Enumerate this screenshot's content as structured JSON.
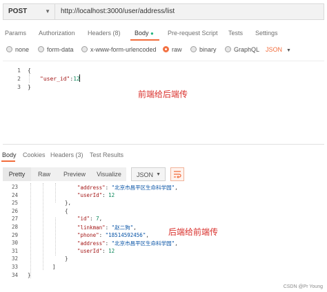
{
  "request": {
    "method": "POST",
    "url": "http://localhost:3000/user/address/list"
  },
  "request_tabs": [
    "Params",
    "Authorization",
    "Headers (8)",
    "Body",
    "Pre-request Script",
    "Tests",
    "Settings"
  ],
  "body_types": [
    "none",
    "form-data",
    "x-www-form-urlencoded",
    "raw",
    "binary",
    "GraphQL"
  ],
  "body_format": "JSON",
  "editor": {
    "lines": [
      {
        "n": "1",
        "text": "{"
      },
      {
        "n": "2",
        "key": "\"user_id\"",
        "sep": ":",
        "val": "12"
      },
      {
        "n": "3",
        "text": "}"
      }
    ],
    "annotation": "前端给后端传"
  },
  "response_tabs": [
    "Body",
    "Cookies",
    "Headers (3)",
    "Test Results"
  ],
  "response_toolbar": {
    "pretty": "Pretty",
    "raw": "Raw",
    "preview": "Preview",
    "visualize": "Visualize",
    "format": "JSON"
  },
  "response": {
    "lines": [
      {
        "n": "23",
        "indent": 16,
        "key": "\"address\"",
        "val": "\"北京市昌平区生命科学园\"",
        "tail": ","
      },
      {
        "n": "24",
        "indent": 16,
        "key": "\"userId\"",
        "val": "12",
        "num": true
      },
      {
        "n": "25",
        "indent": 12,
        "text": "},"
      },
      {
        "n": "26",
        "indent": 12,
        "text": "{"
      },
      {
        "n": "27",
        "indent": 16,
        "key": "\"id\"",
        "val": "7",
        "num": true,
        "tail": ","
      },
      {
        "n": "28",
        "indent": 16,
        "key": "\"linkman\"",
        "val": "\"赵二狗\"",
        "tail": ","
      },
      {
        "n": "29",
        "indent": 16,
        "key": "\"phone\"",
        "val": "\"18514592456\"",
        "tail": ","
      },
      {
        "n": "30",
        "indent": 16,
        "key": "\"address\"",
        "val": "\"北京市昌平区生命科学园\"",
        "tail": ","
      },
      {
        "n": "31",
        "indent": 16,
        "key": "\"userId\"",
        "val": "12",
        "num": true
      },
      {
        "n": "32",
        "indent": 12,
        "text": "}"
      },
      {
        "n": "33",
        "indent": 8,
        "text": "]"
      },
      {
        "n": "34",
        "indent": 0,
        "text": "}"
      }
    ],
    "annotation": "后端给前端传"
  },
  "watermark": "CSDN @Pr Young"
}
